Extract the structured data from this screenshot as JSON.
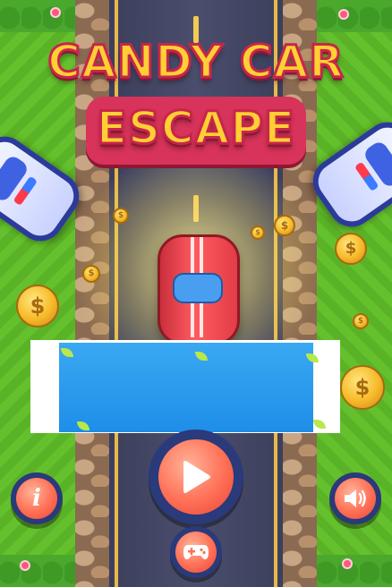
{
  "title": {
    "line1": "CANDY CAR",
    "line2": "ESCAPE"
  },
  "buttons": {
    "play_icon": "play-icon",
    "info_label": "i",
    "sound_icon": "speaker-icon",
    "controls_icon": "gamepad-icon"
  },
  "coins": {
    "symbol": "$"
  },
  "colors": {
    "title_fill": "#ffcf33",
    "title_outline": "#c7264b",
    "button_face": "#ff6f55",
    "button_ring": "#2a3a7a",
    "road": "#4a4e6c",
    "grass": "#5cb526",
    "banner": "#1e8ee8"
  }
}
